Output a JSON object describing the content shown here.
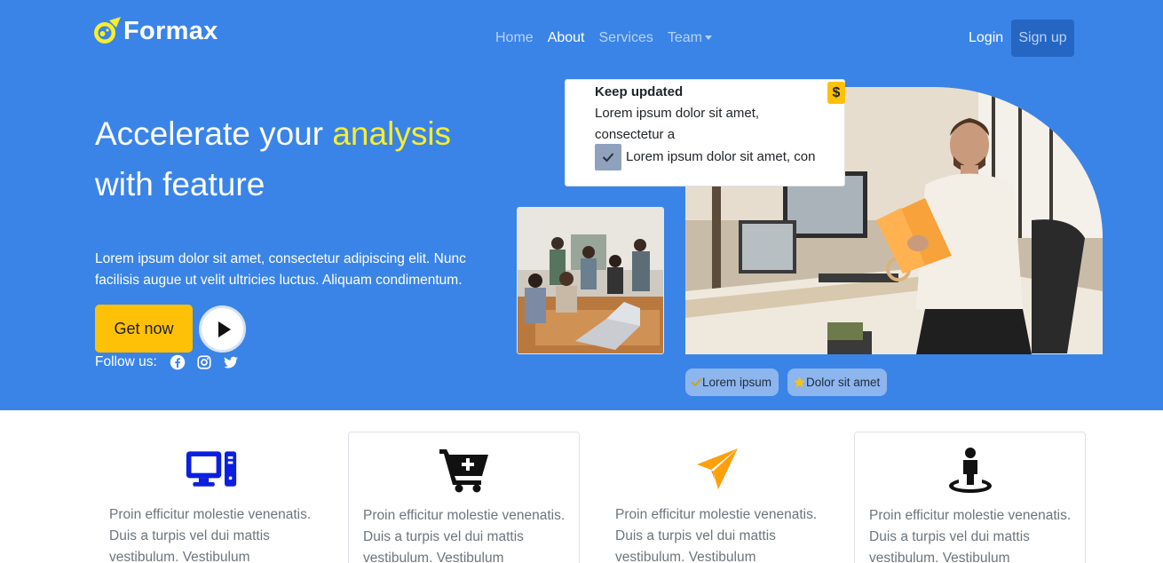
{
  "brand": {
    "name": "Formax",
    "logo_icon": "meteor-icon"
  },
  "nav": {
    "items": [
      {
        "label": "Home",
        "active": false
      },
      {
        "label": "About",
        "active": true
      },
      {
        "label": "Services",
        "active": false
      },
      {
        "label": "Team",
        "active": false,
        "dropdown": true
      }
    ],
    "login_label": "Login",
    "signup_label": "Sign up"
  },
  "hero": {
    "headline_part1": "Accelerate your ",
    "headline_accent": "analysis",
    "headline_part2": "with feature",
    "lead": "Lorem ipsum dolor sit amet, consectetur adipiscing elit. Nunc facilisis augue ut velit ultricies luctus. Aliquam condimentum.",
    "cta_label": "Get now",
    "play_icon": "play-icon",
    "follow_label": "Follow us:",
    "social": [
      "facebook-icon",
      "instagram-icon",
      "twitter-icon"
    ]
  },
  "update_card": {
    "title": "Keep updated",
    "text": "Lorem ipsum dolor sit amet, consectetur a",
    "check_text": "Lorem ipsum dolor sit amet, con",
    "badge_symbol": "$"
  },
  "pills": [
    {
      "label": "Lorem ipsum",
      "icon": "check-icon"
    },
    {
      "label": "Dolor sit amet",
      "icon": "star-icon"
    }
  ],
  "features": [
    {
      "icon": "desktop-icon",
      "text": "Proin efficitur molestie venenatis. Duis a turpis vel dui mattis vestibulum. Vestibulum"
    },
    {
      "icon": "cart-plus-icon",
      "text": "Proin efficitur molestie venenatis. Duis a turpis vel dui mattis vestibulum. Vestibulum"
    },
    {
      "icon": "paper-plane-icon",
      "text": "Proin efficitur molestie venenatis. Duis a turpis vel dui mattis vestibulum. Vestibulum"
    },
    {
      "icon": "street-view-icon",
      "text": "Proin efficitur molestie venenatis. Duis a turpis vel dui mattis vestibulum. Vestibulum"
    }
  ],
  "colors": {
    "hero_bg": "#3a84e8",
    "accent_yellow": "#f8ee2b",
    "button_yellow": "#ffc107",
    "signup_bg": "#2466c2",
    "feature_blue": "#0b1fe0",
    "feature_orange": "#ff9f0a"
  }
}
